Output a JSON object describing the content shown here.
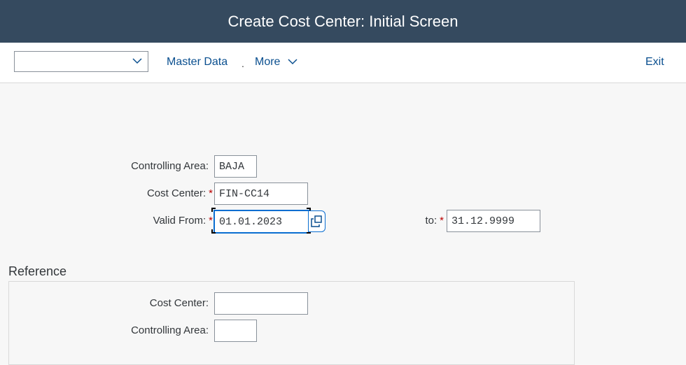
{
  "title": "Create Cost Center: Initial Screen",
  "toolbar": {
    "dropdown_value": "",
    "master_data": "Master Data",
    "separator": ".",
    "more": "More",
    "exit": "Exit"
  },
  "form": {
    "controlling_area_label": "Controlling Area:",
    "controlling_area": "BAJA",
    "cost_center_label": "Cost Center:",
    "cost_center": "FIN-CC14",
    "valid_from_label": "Valid From:",
    "valid_from": "01.01.2023",
    "to_label": "to:",
    "valid_to": "31.12.9999",
    "required_mark": "*"
  },
  "reference": {
    "title": "Reference",
    "cost_center_label": "Cost Center:",
    "cost_center": "",
    "controlling_area_label": "Controlling Area:",
    "controlling_area": ""
  }
}
